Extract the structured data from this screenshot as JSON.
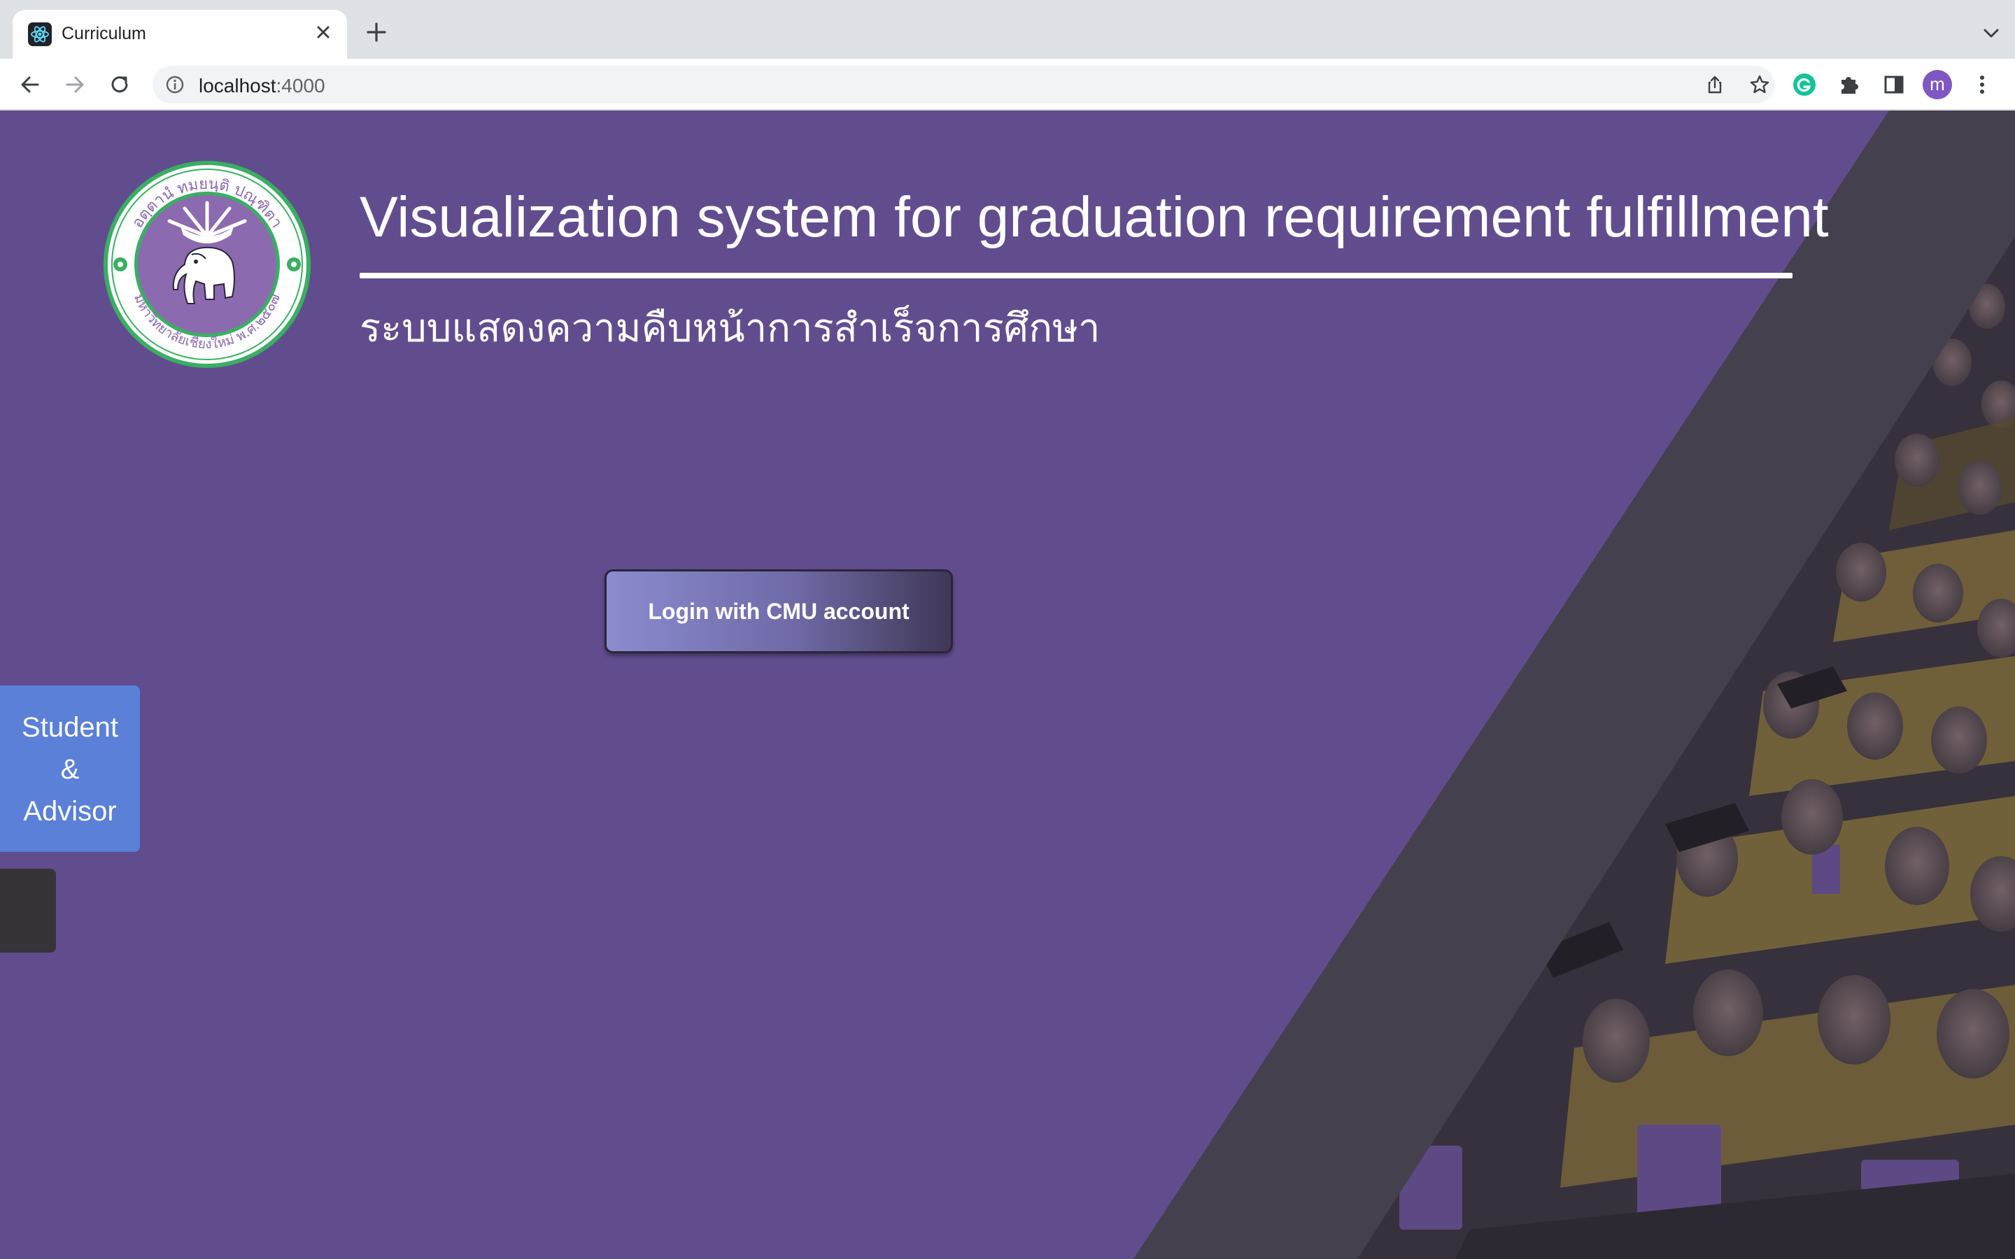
{
  "browser": {
    "tab_title": "Curriculum",
    "url_host": "localhost",
    "url_port": ":4000",
    "profile_initial": "m",
    "icons": [
      "react-favicon",
      "close-icon",
      "plus-icon",
      "chevron-down-icon",
      "back-icon",
      "forward-icon",
      "reload-icon",
      "info-icon",
      "share-icon",
      "star-icon",
      "grammarly-icon",
      "puzzle-icon",
      "side-panel-icon",
      "kebab-menu-icon"
    ]
  },
  "hero": {
    "title": "Visualization system for graduation requirement fulfillment",
    "subtitle_thai": "ระบบแสดงความคืบหน้าการสำเร็จการศึกษา",
    "logo_text_top": "อตฺตานํ ทมยนฺติ ปณฺฑิตา",
    "logo_text_bottom": "มหาวิทยาลัยเชียงใหม่ พ.ศ.๒๕๐๗"
  },
  "login": {
    "button_label": "Login with CMU account"
  },
  "role_tabs": {
    "line1": "Student",
    "line2": "&",
    "line3": "Advisor"
  },
  "colors": {
    "page_bg": "#614d8e",
    "diagonal_band": "#45404d",
    "role_tab": "#5a80d8",
    "logo_green": "#3aae62",
    "logo_purple": "#8c6aaf"
  }
}
